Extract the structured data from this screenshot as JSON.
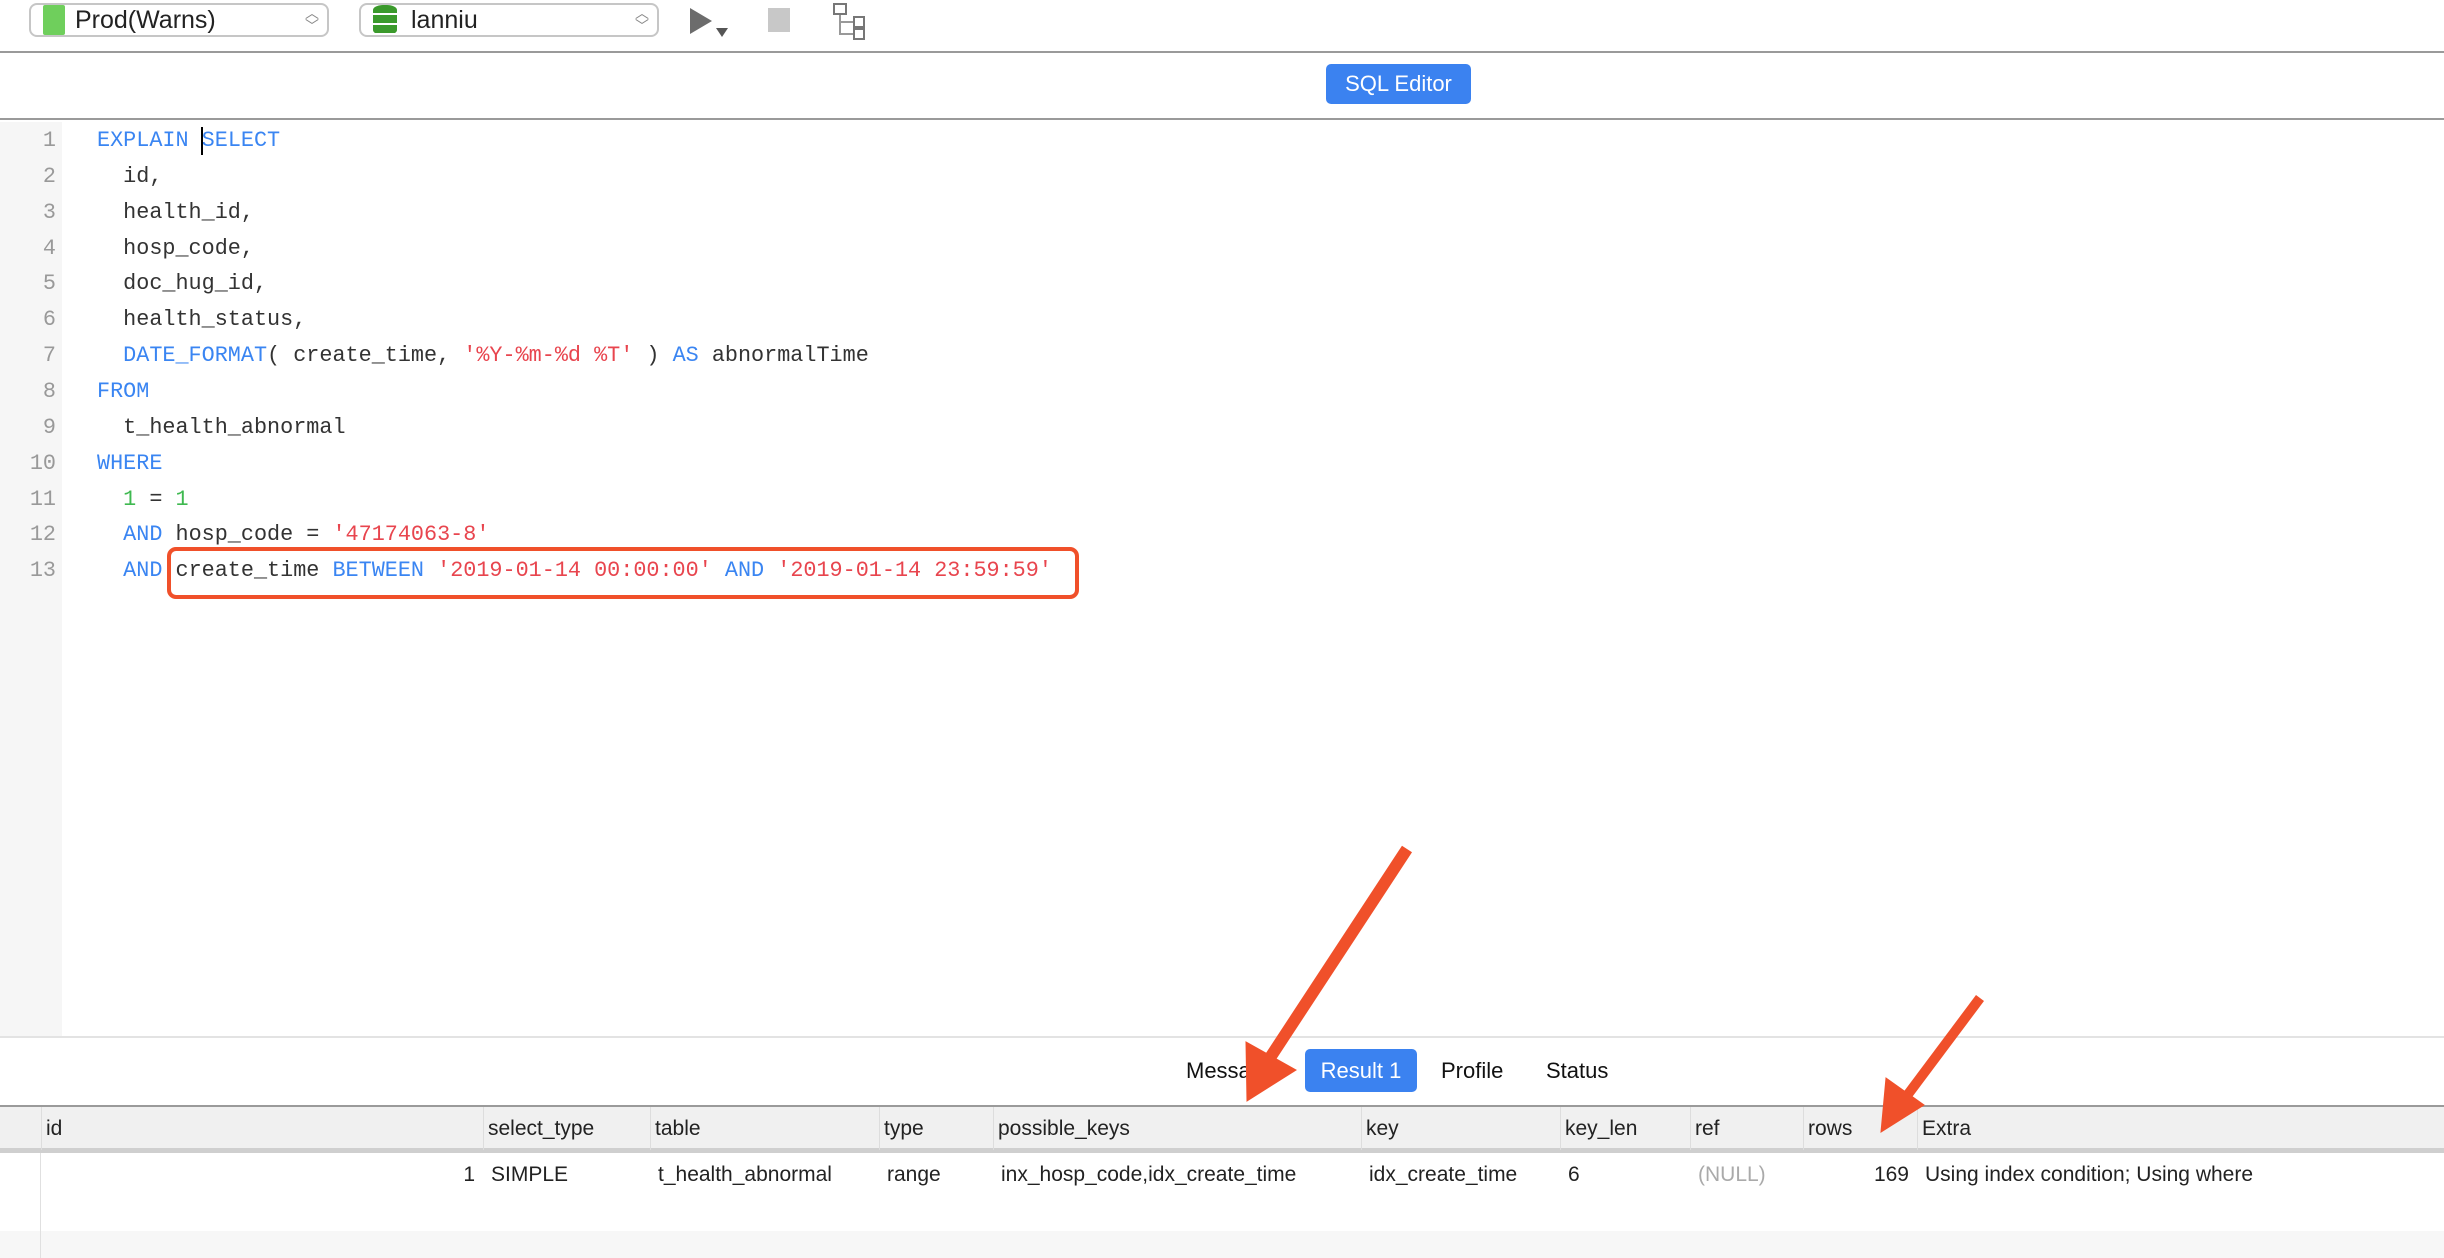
{
  "toolbar": {
    "connection": "Prod(Warns)",
    "database": "lanniu",
    "icons": [
      "mysql-dolphin-icon",
      "database-icon",
      "run-icon",
      "stop-icon",
      "explain-tree-icon"
    ]
  },
  "editor": {
    "button": "SQL Editor",
    "lines": [
      [
        {
          "t": "EXPLAIN ",
          "c": "kw"
        },
        {
          "t": "SELECT",
          "c": "kw"
        }
      ],
      [
        {
          "t": "  id,",
          "c": ""
        }
      ],
      [
        {
          "t": "  health_id,",
          "c": ""
        }
      ],
      [
        {
          "t": "  hosp_code,",
          "c": ""
        }
      ],
      [
        {
          "t": "  doc_hug_id,",
          "c": ""
        }
      ],
      [
        {
          "t": "  health_status,",
          "c": ""
        }
      ],
      [
        {
          "t": "  DATE_FORMAT",
          "c": "kw"
        },
        {
          "t": "( create_time, ",
          "c": ""
        },
        {
          "t": "'%Y-%m-%d %T'",
          "c": "str"
        },
        {
          "t": " ) ",
          "c": ""
        },
        {
          "t": "AS",
          "c": "kw"
        },
        {
          "t": " abnormalTime",
          "c": ""
        }
      ],
      [
        {
          "t": "FROM",
          "c": "kw"
        }
      ],
      [
        {
          "t": "  t_health_abnormal",
          "c": ""
        }
      ],
      [
        {
          "t": "WHERE",
          "c": "kw"
        }
      ],
      [
        {
          "t": "  1",
          "c": "num"
        },
        {
          "t": " = ",
          "c": ""
        },
        {
          "t": "1",
          "c": "num"
        }
      ],
      [
        {
          "t": "  AND",
          "c": "kw"
        },
        {
          "t": " hosp_code = ",
          "c": ""
        },
        {
          "t": "'47174063-8'",
          "c": "str"
        }
      ],
      [
        {
          "t": "  AND",
          "c": "kw"
        },
        {
          "t": " create_time ",
          "c": ""
        },
        {
          "t": "BETWEEN",
          "c": "kw"
        },
        {
          "t": " ",
          "c": ""
        },
        {
          "t": "'2019-01-14 00:00:00'",
          "c": "str"
        },
        {
          "t": " ",
          "c": ""
        },
        {
          "t": "AND",
          "c": "kw"
        },
        {
          "t": " ",
          "c": ""
        },
        {
          "t": "'2019-01-14 23:59:59'",
          "c": "str"
        }
      ]
    ]
  },
  "results": {
    "tabs": [
      "Message",
      "Result 1",
      "Profile",
      "Status"
    ],
    "active_tab": "Result 1",
    "columns": [
      "id",
      "select_type",
      "table",
      "type",
      "possible_keys",
      "key",
      "key_len",
      "ref",
      "rows",
      "Extra"
    ],
    "rows": [
      [
        "1",
        "SIMPLE",
        "t_health_abnormal",
        "range",
        "inx_hosp_code,idx_create_time",
        "idx_create_time",
        "6",
        "(NULL)",
        "169",
        "Using index condition; Using where"
      ]
    ]
  },
  "colors": {
    "accent": "#3b82f0",
    "annotation": "#f0502a",
    "keyword": "#3a85f2",
    "string": "#e8454e"
  }
}
